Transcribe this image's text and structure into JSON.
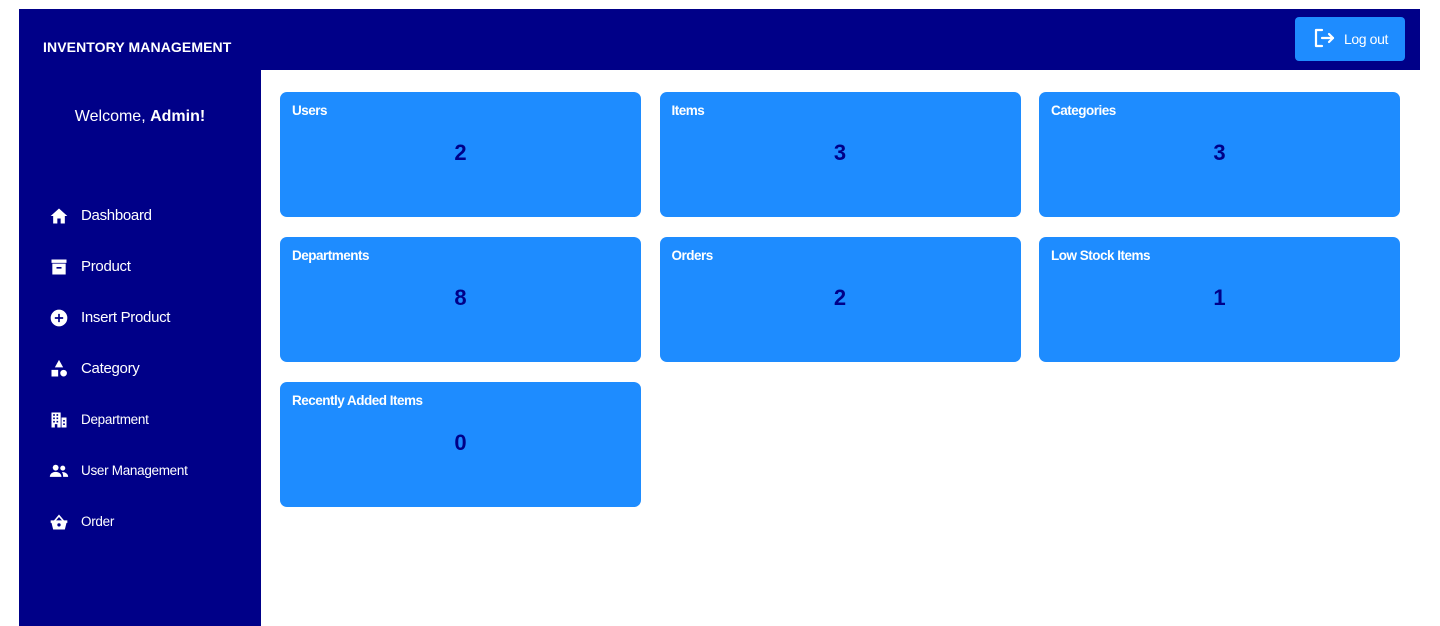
{
  "sidebar": {
    "brand": "INVENTORY MANAGEMENT",
    "welcome_prefix": "Welcome, ",
    "welcome_name": "Admin!",
    "items": [
      {
        "label": "Dashboard",
        "icon": "home-icon"
      },
      {
        "label": "Product",
        "icon": "archive-icon"
      },
      {
        "label": "Insert Product",
        "icon": "plus-circle-icon"
      },
      {
        "label": "Category",
        "icon": "shapes-icon"
      },
      {
        "label": "Department",
        "icon": "building-icon"
      },
      {
        "label": "User Management",
        "icon": "users-icon"
      },
      {
        "label": "Order",
        "icon": "basket-icon"
      }
    ]
  },
  "topbar": {
    "logout_label": "Log out",
    "logout_icon": "logout-icon"
  },
  "cards": [
    {
      "title": "Users",
      "value": "2"
    },
    {
      "title": "Items",
      "value": "3"
    },
    {
      "title": "Categories",
      "value": "3"
    },
    {
      "title": "Departments",
      "value": "8"
    },
    {
      "title": "Orders",
      "value": "2"
    },
    {
      "title": "Low Stock Items",
      "value": "1"
    },
    {
      "title": "Recently Added Items",
      "value": "0"
    }
  ],
  "colors": {
    "navy": "#000088",
    "card_blue": "#1e8cff",
    "white": "#ffffff"
  }
}
